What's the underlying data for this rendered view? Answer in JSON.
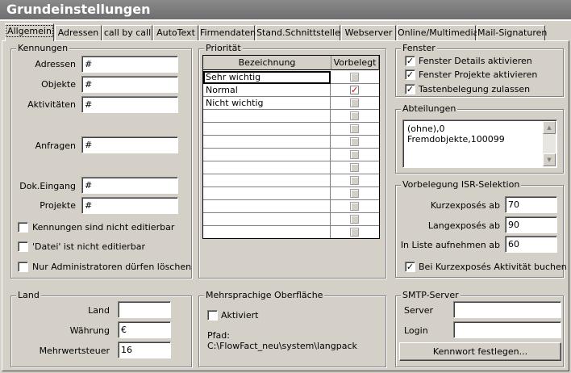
{
  "window": {
    "title": "Grundeinstellungen"
  },
  "tabs": [
    {
      "label": "Allgemein"
    },
    {
      "label": "Adressen"
    },
    {
      "label": "call by call"
    },
    {
      "label": "AutoText"
    },
    {
      "label": "Firmendaten"
    },
    {
      "label": "Stand.Schnittstellen"
    },
    {
      "label": "Webserver"
    },
    {
      "label": "Online/Multimedia"
    },
    {
      "label": "Mail-Signaturen"
    }
  ],
  "kennungen": {
    "legend": "Kennungen",
    "fields": [
      {
        "label": "Adressen",
        "value": "#"
      },
      {
        "label": "Objekte",
        "value": "#"
      },
      {
        "label": "Aktivitäten",
        "value": "#"
      },
      {
        "label": "Anfragen",
        "value": "#"
      },
      {
        "label": "Dok.Eingang",
        "value": "#"
      },
      {
        "label": "Projekte",
        "value": "#"
      }
    ],
    "checkboxes": [
      {
        "label": "Kennungen sind nicht editierbar",
        "checked": false
      },
      {
        "label": "'Datei' ist nicht editierbar",
        "checked": false
      },
      {
        "label": "Nur Administratoren dürfen löschen",
        "checked": false
      }
    ]
  },
  "prioritaet": {
    "legend": "Priorität",
    "col_name": "Bezeichnung",
    "col_default": "Vorbelegt",
    "rows": [
      {
        "name": "Sehr wichtig",
        "default": false
      },
      {
        "name": "Normal",
        "default": true
      },
      {
        "name": "Nicht wichtig",
        "default": false
      }
    ],
    "check_glyph": "✓"
  },
  "fenster": {
    "legend": "Fenster",
    "checkboxes": [
      {
        "label": "Fenster Details aktivieren",
        "checked": true
      },
      {
        "label": "Fenster Projekte aktivieren",
        "checked": true
      },
      {
        "label": "Tastenbelegung zulassen",
        "checked": true
      }
    ]
  },
  "abteilungen": {
    "legend": "Abteilungen",
    "items": [
      "(ohne),0",
      "Fremdobjekte,100099"
    ]
  },
  "isr": {
    "legend": "Vorbelegung ISR-Selektion",
    "fields": [
      {
        "label": "Kurzexposés ab",
        "value": "70"
      },
      {
        "label": "Langexposés ab",
        "value": "90"
      },
      {
        "label": "In Liste aufnehmen ab",
        "value": "60"
      }
    ],
    "checkbox": {
      "label": "Bei Kurzexposés Aktivität buchen",
      "checked": true
    }
  },
  "land": {
    "legend": "Land",
    "fields": [
      {
        "label": "Land",
        "value": ""
      },
      {
        "label": "Währung",
        "value": "€"
      },
      {
        "label": "Mehrwertsteuer",
        "value": "16"
      }
    ]
  },
  "mehrsprachig": {
    "legend": "Mehrsprachige Oberfläche",
    "checkbox": {
      "label": "Aktiviert",
      "checked": false
    },
    "path_label": "Pfad:",
    "path_value": "C:\\FlowFact_neu\\system\\langpack"
  },
  "smtp": {
    "legend": "SMTP-Server",
    "server_label": "Server",
    "server_value": "",
    "login_label": "Login",
    "login_value": "",
    "password_button": "Kennwort festlegen..."
  },
  "check_mark": "✓"
}
